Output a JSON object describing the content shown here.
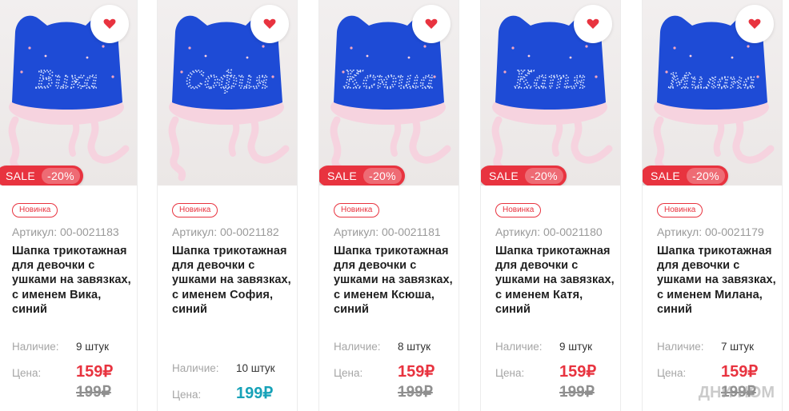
{
  "colors": {
    "accent": "#e8333f",
    "teal": "#17a2b8",
    "hat_blue": "#1e4bd6",
    "lining_pink": "#f6d3df"
  },
  "labels": {
    "stock": "Наличие:",
    "price": "Цена:",
    "sku_prefix": "Артикул:"
  },
  "products": [
    {
      "name": "Вика",
      "badge": "Новинка",
      "sale": "SALE",
      "discount": "-20%",
      "sku": "Артикул: 00-0021183",
      "title": "Шапка трикотажная для девочки с ушками на завязках, с именем Вика, синий",
      "stock": "9 штук",
      "price": "159₽",
      "old_price": "199₽"
    },
    {
      "name": "София",
      "badge": "Новинка",
      "sale": "",
      "discount": "",
      "sku": "Артикул: 00-0021182",
      "title": "Шапка трикотажная для девочки с ушками на завязках, с именем София, синий",
      "stock": "10 штук",
      "price": "199₽",
      "old_price": ""
    },
    {
      "name": "Ксюша",
      "badge": "Новинка",
      "sale": "SALE",
      "discount": "-20%",
      "sku": "Артикул: 00-0021181",
      "title": "Шапка трикотажная для девочки с ушками на завязках, с именем Ксюша, синий",
      "stock": "8 штук",
      "price": "159₽",
      "old_price": "199₽"
    },
    {
      "name": "Катя",
      "badge": "Новинка",
      "sale": "SALE",
      "discount": "-20%",
      "sku": "Артикул: 00-0021180",
      "title": "Шапка трикотажная для девочки с ушками на завязках, с именем Катя, синий",
      "stock": "9 штук",
      "price": "159₽",
      "old_price": "199₽"
    },
    {
      "name": "Милана",
      "badge": "Новинка",
      "sale": "SALE",
      "discount": "-20%",
      "sku": "Артикул: 00-0021179",
      "title": "Шапка трикотажная для девочки с ушками на завязках, с именем Милана, синий",
      "stock": "7 штук",
      "price": "159₽",
      "old_price": "199₽"
    }
  ],
  "watermark": "ДНИ НОМ"
}
